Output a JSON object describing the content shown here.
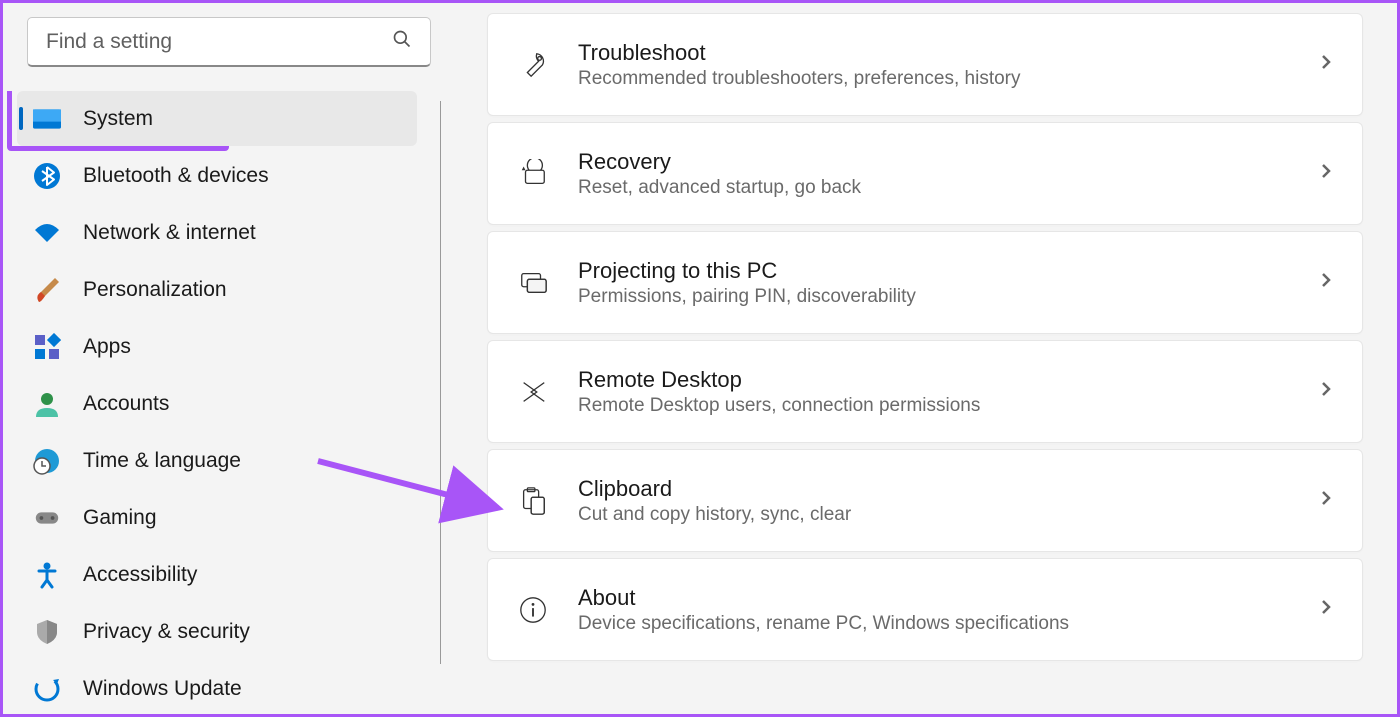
{
  "search": {
    "placeholder": "Find a setting"
  },
  "sidebar": {
    "items": [
      {
        "label": "System",
        "icon": "system",
        "selected": true
      },
      {
        "label": "Bluetooth & devices",
        "icon": "bluetooth"
      },
      {
        "label": "Network & internet",
        "icon": "wifi"
      },
      {
        "label": "Personalization",
        "icon": "brush"
      },
      {
        "label": "Apps",
        "icon": "apps"
      },
      {
        "label": "Accounts",
        "icon": "person"
      },
      {
        "label": "Time & language",
        "icon": "clock-globe"
      },
      {
        "label": "Gaming",
        "icon": "gamepad"
      },
      {
        "label": "Accessibility",
        "icon": "accessibility"
      },
      {
        "label": "Privacy & security",
        "icon": "shield"
      },
      {
        "label": "Windows Update",
        "icon": "update"
      }
    ]
  },
  "main": {
    "cards": [
      {
        "icon": "wrench",
        "title": "Troubleshoot",
        "desc": "Recommended troubleshooters, preferences, history"
      },
      {
        "icon": "recovery",
        "title": "Recovery",
        "desc": "Reset, advanced startup, go back"
      },
      {
        "icon": "project",
        "title": "Projecting to this PC",
        "desc": "Permissions, pairing PIN, discoverability"
      },
      {
        "icon": "remote",
        "title": "Remote Desktop",
        "desc": "Remote Desktop users, connection permissions"
      },
      {
        "icon": "clipboard",
        "title": "Clipboard",
        "desc": "Cut and copy history, sync, clear"
      },
      {
        "icon": "info",
        "title": "About",
        "desc": "Device specifications, rename PC, Windows specifications"
      }
    ]
  },
  "annotations": {
    "highlight_nav_index": 0,
    "arrow_target_card_index": 4
  }
}
